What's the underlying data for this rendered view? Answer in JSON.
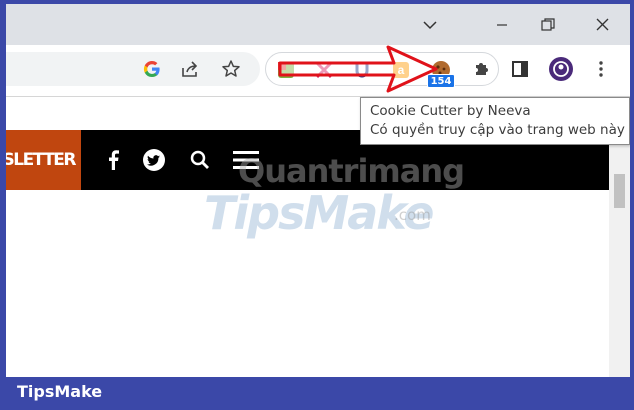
{
  "tooltip": {
    "line1": "Cookie Cutter by Neeva",
    "line2": "Có quyền truy cập vào trang web này"
  },
  "extensions": {
    "badge_count": "154",
    "items": [
      "green-extension-icon",
      "x-extension-icon",
      "u-extension-icon",
      "amazon-extension-icon",
      "cookie-cutter-icon"
    ]
  },
  "site": {
    "newsletter_label": "SLETTER"
  },
  "watermark": {
    "top": "Quantrimang",
    "main": "TipsMake",
    "suffix": ".com"
  },
  "footer": {
    "brand": "TipsMake"
  },
  "colors": {
    "border": "#3b48a8",
    "newsletter_bg": "#c0460f",
    "site_nav_bg": "#000000",
    "arrow": "#e0121a",
    "badge": "#1a73e8"
  }
}
